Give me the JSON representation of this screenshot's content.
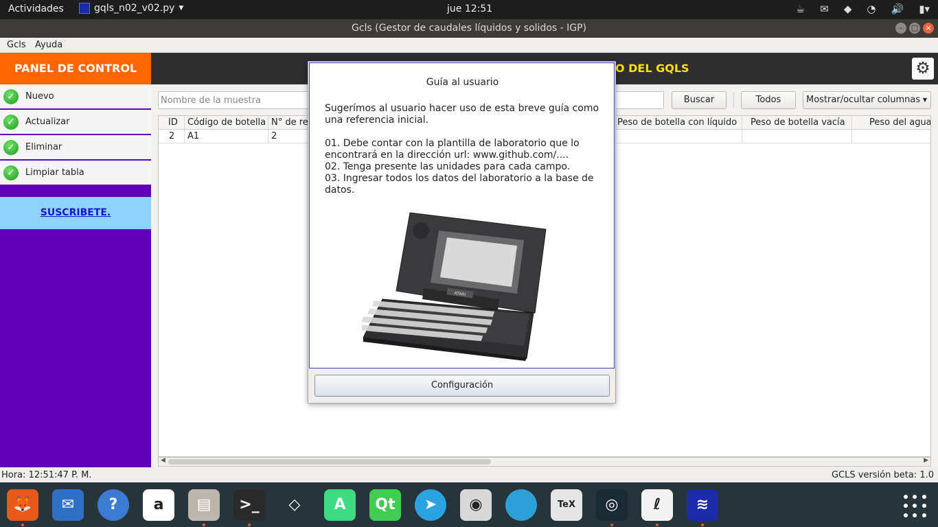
{
  "topbar": {
    "activities": "Actividades",
    "app_name": "gqls_n02_v02.py",
    "clock": "jue 12:51"
  },
  "window": {
    "title": "Gcls (Gestor de caudales líquidos y solidos - IGP)"
  },
  "menubar": {
    "items": [
      "Gcls",
      "Ayuda"
    ]
  },
  "sidebar": {
    "panel_title": "PANEL DE CONTROL",
    "buttons": [
      "Nuevo",
      "Actualizar",
      "Eliminar",
      "Limpiar tabla"
    ],
    "subscribe": "SUSCRIBETE."
  },
  "header": {
    "title_visible": "IO DEL GQLS"
  },
  "search": {
    "placeholder": "Nombre de la muestra",
    "search_button": "Buscar",
    "all_button": "Todos",
    "columns_button": "Mostrar/ocultar columnas"
  },
  "table": {
    "headers": [
      "ID",
      "Código de botella",
      "N° de re",
      "Peso de botella con líquido",
      "Peso de botella vacía",
      "Peso del agua"
    ],
    "rows": [
      [
        "2",
        "A1",
        "2",
        "",
        "",
        ""
      ]
    ]
  },
  "status": {
    "left": "Hora: 12:51:47 P. M.",
    "right": "GCLS versión beta: 1.0"
  },
  "dialog": {
    "title": "Guía al usuario",
    "intro": "Sugerímos al usuario hacer uso de esta breve guía como una referencia inicial.",
    "step1": "01. Debe contar con la plantilla de laboratorio que lo encontrará en la dirección url: www.github.com/....",
    "step2": "02. Tenga presente las unidades para cada campo.",
    "step3": "03. Ingresar todos los datos del laboratorio a la base de datos.",
    "config_button": "Configuración",
    "laptop_brand": "ATARI"
  },
  "dock": {
    "apps": [
      {
        "icon": "firefox-icon",
        "color": "#e8591a"
      },
      {
        "icon": "thunderbird-icon",
        "color": "#2f6fc6"
      },
      {
        "icon": "help-icon",
        "color": "#3b7bd3"
      },
      {
        "icon": "amazon-icon",
        "color": "#ffffff"
      },
      {
        "icon": "files-icon",
        "color": "#bcb6ad"
      },
      {
        "icon": "terminal-icon",
        "color": "#2b2b2b"
      },
      {
        "icon": "unity-icon",
        "color": "#27343a"
      },
      {
        "icon": "android-studio-icon",
        "color": "#3ddc84"
      },
      {
        "icon": "qt-icon",
        "color": "#41cd52"
      },
      {
        "icon": "telegram-icon",
        "color": "#2aa3e0"
      },
      {
        "icon": "camera-icon",
        "color": "#d8d8d8"
      },
      {
        "icon": "sphere-icon",
        "color": "#2ea0d8"
      },
      {
        "icon": "texmaker-icon",
        "color": "#e6e6e6"
      },
      {
        "icon": "gitkraken-icon",
        "color": "#1a2b33"
      },
      {
        "icon": "pdf-reader-icon",
        "color": "#f2f2f2"
      },
      {
        "icon": "gqls-app-icon",
        "color": "#1c2aa8"
      }
    ]
  }
}
